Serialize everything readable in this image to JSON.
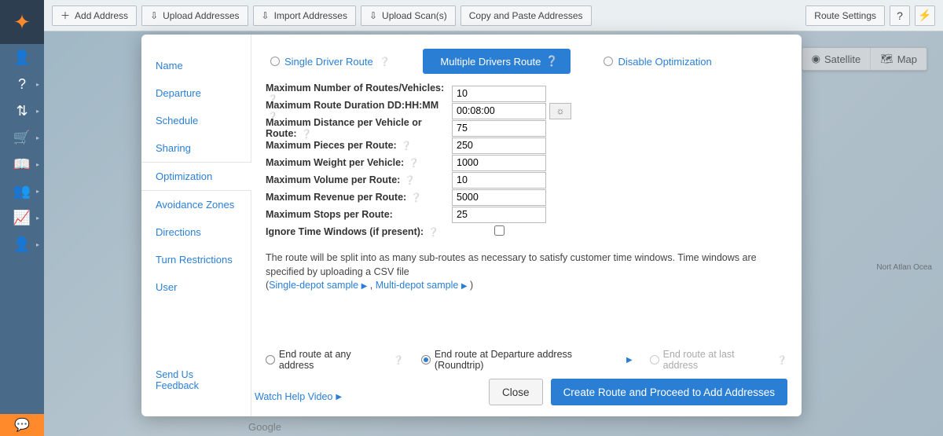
{
  "toolbar": {
    "add_address": "Add Address",
    "upload_addresses": "Upload Addresses",
    "import_addresses": "Import Addresses",
    "upload_scans": "Upload Scan(s)",
    "copy_paste": "Copy and Paste Addresses",
    "route_settings": "Route Settings"
  },
  "map": {
    "satellite": "Satellite",
    "map": "Map",
    "ocean_label": "Nort\nAtlan\nOcea",
    "attribution": "Google"
  },
  "modal": {
    "tabs": [
      "Name",
      "Departure",
      "Schedule",
      "Sharing",
      "Optimization",
      "Avoidance Zones",
      "Directions",
      "Turn Restrictions",
      "User"
    ],
    "active_tab_index": 4,
    "feedback": "Send Us Feedback",
    "help_video": "Watch Help Video"
  },
  "route_type": {
    "single": "Single Driver Route",
    "multiple": "Multiple Drivers Route",
    "disable": "Disable Optimization"
  },
  "form": {
    "max_routes_label": "Maximum Number of Routes/Vehicles:",
    "max_routes_value": "10",
    "max_duration_label": "Maximum Route Duration DD:HH:MM",
    "max_duration_value": "00:08:00",
    "max_distance_label": "Maximum Distance per Vehicle or Route:",
    "max_distance_value": "75",
    "max_pieces_label": "Maximum Pieces per Route:",
    "max_pieces_value": "250",
    "max_weight_label": "Maximum Weight per Vehicle:",
    "max_weight_value": "1000",
    "max_volume_label": "Maximum Volume per Route:",
    "max_volume_value": "10",
    "max_revenue_label": "Maximum Revenue per Route:",
    "max_revenue_value": "5000",
    "max_stops_label": "Maximum Stops per Route:",
    "max_stops_value": "25",
    "ignore_tw_label": "Ignore Time Windows (if present):"
  },
  "note": {
    "text": "The route will be split into as many sub-routes as necessary to satisfy customer time windows. Time windows are specified by uploading a CSV file",
    "single_depot": "Single-depot sample",
    "multi_depot": "Multi-depot sample"
  },
  "end_options": {
    "any": "End route at any address",
    "roundtrip": "End route at Departure address (Roundtrip)",
    "last": "End route at last address"
  },
  "buttons": {
    "close": "Close",
    "create": "Create Route and Proceed to Add Addresses"
  }
}
